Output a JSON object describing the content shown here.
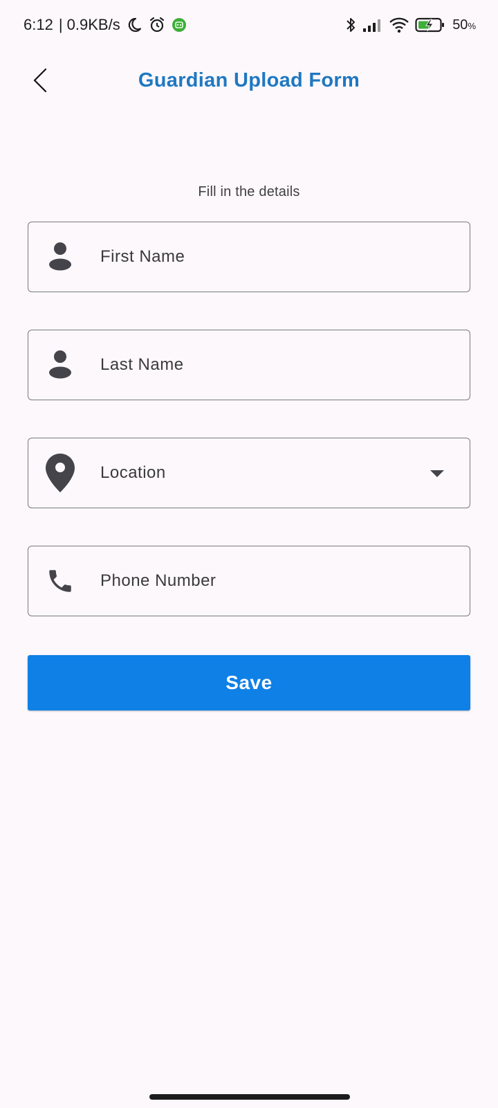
{
  "status_bar": {
    "time": "6:12",
    "network_speed": "| 0.9KB/s",
    "battery_percent": "50",
    "battery_unit": "%",
    "icons": [
      "moon-icon",
      "alarm-icon",
      "notification-app-icon",
      "bluetooth-icon",
      "cellular-signal-icon",
      "wifi-icon",
      "battery-charging-icon"
    ]
  },
  "header": {
    "title": "Guardian Upload Form",
    "back_icon": "chevron-left-icon"
  },
  "form": {
    "subtitle": "Fill in the details",
    "fields": [
      {
        "placeholder": "First Name",
        "icon": "person-icon"
      },
      {
        "placeholder": "Last Name",
        "icon": "person-icon"
      },
      {
        "placeholder": "Location",
        "icon": "location-pin-icon",
        "dropdown": true
      },
      {
        "placeholder": "Phone Number",
        "icon": "phone-icon"
      }
    ],
    "save_label": "Save"
  },
  "colors": {
    "background": "#fdf8fc",
    "title": "#1f78c1",
    "button": "#0f80e6",
    "icon": "#45444b",
    "border": "#7a7a7c"
  }
}
